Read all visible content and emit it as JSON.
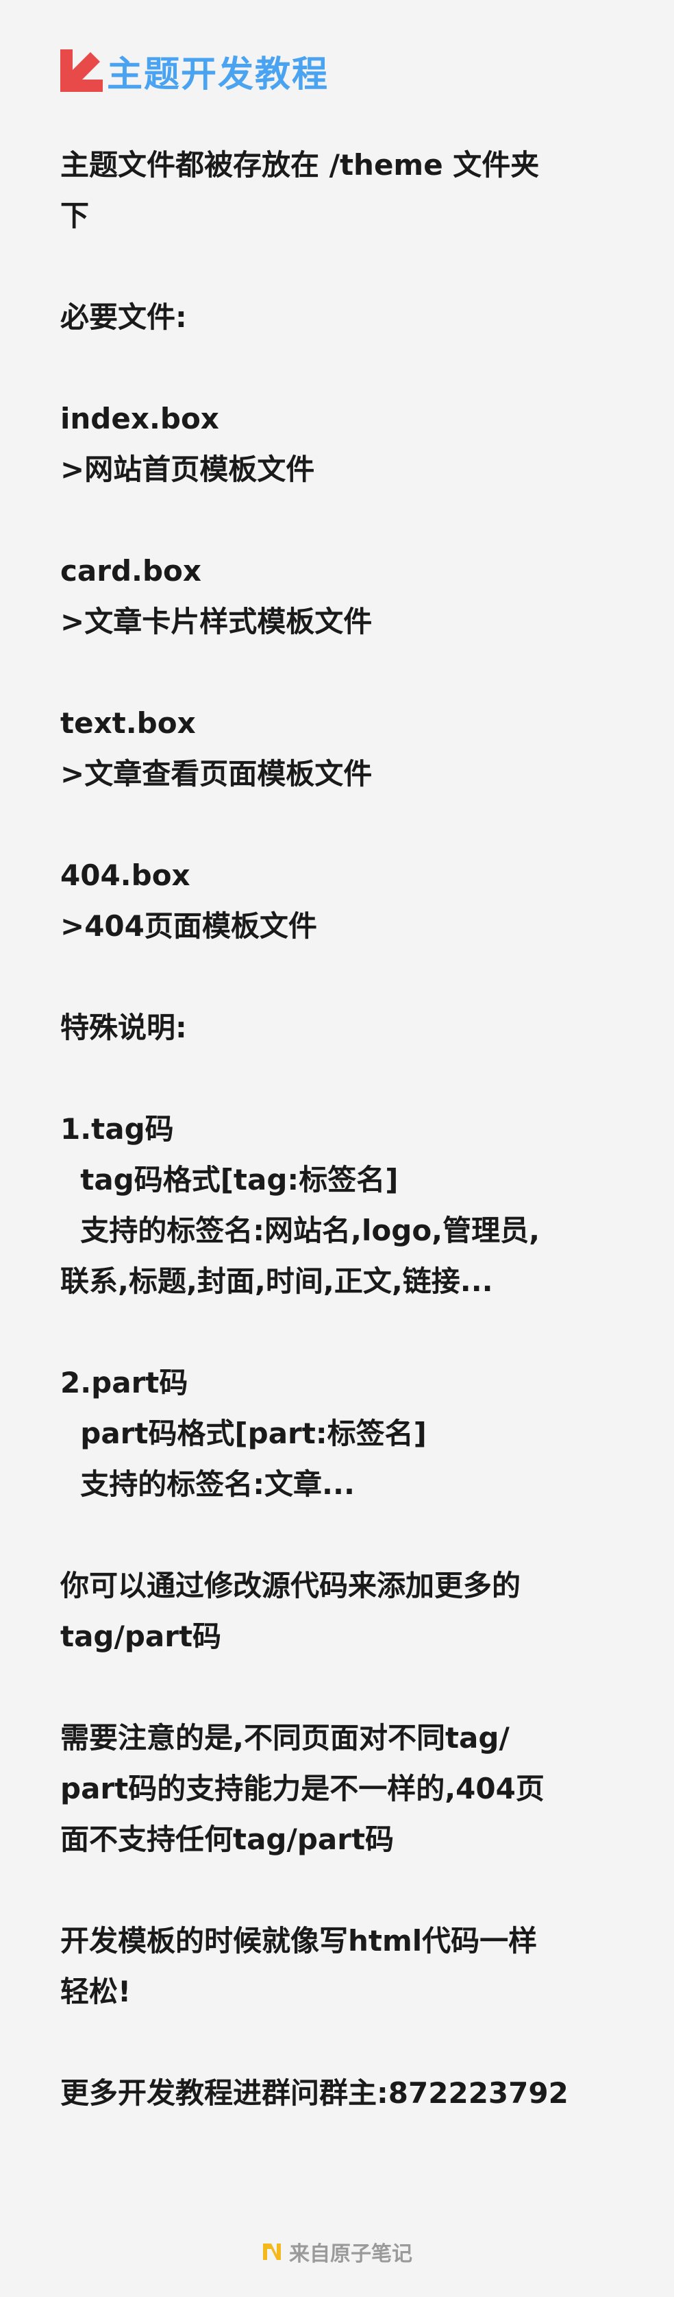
{
  "title": "主题开发教程",
  "lines": [
    {
      "text": "主题文件都被存放在 /theme 文件夹"
    },
    {
      "text": "下"
    },
    {
      "text": ""
    },
    {
      "text": "必要文件:"
    },
    {
      "text": ""
    },
    {
      "text": "index.box"
    },
    {
      "text": ">网站首页模板文件"
    },
    {
      "text": ""
    },
    {
      "text": "card.box"
    },
    {
      "text": ">文章卡片样式模板文件"
    },
    {
      "text": ""
    },
    {
      "text": "text.box"
    },
    {
      "text": ">文章查看页面模板文件"
    },
    {
      "text": ""
    },
    {
      "text": "404.box"
    },
    {
      "text": ">404页面模板文件"
    },
    {
      "text": ""
    },
    {
      "text": "特殊说明:"
    },
    {
      "text": ""
    },
    {
      "text": "1.tag码"
    },
    {
      "text": "  tag码格式[tag:标签名]"
    },
    {
      "text": "  支持的标签名:网站名,logo,管理员,"
    },
    {
      "text": "联系,标题,封面,时间,正文,链接..."
    },
    {
      "text": ""
    },
    {
      "text": "2.part码"
    },
    {
      "text": "  part码格式[part:标签名]"
    },
    {
      "text": "  支持的标签名:文章..."
    },
    {
      "text": ""
    },
    {
      "text": "你可以通过修改源代码来添加更多的"
    },
    {
      "text": "tag/part码"
    },
    {
      "text": ""
    },
    {
      "text": "需要注意的是,不同页面对不同tag/"
    },
    {
      "text": "part码的支持能力是不一样的,404页"
    },
    {
      "text": "面不支持任何tag/part码"
    },
    {
      "text": ""
    },
    {
      "text": "开发模板的时候就像写html代码一样"
    },
    {
      "text": "轻松!"
    },
    {
      "text": ""
    },
    {
      "text": "更多开发教程进群问群主:872223792"
    }
  ],
  "footer": {
    "text": "来自原子笔记",
    "logo_icon": "n-logo-icon"
  },
  "colors": {
    "title": "#4aa3f0",
    "arrow": "#e84a4a",
    "background": "#f4f4f4",
    "footer_logo": "#f2b81c"
  }
}
